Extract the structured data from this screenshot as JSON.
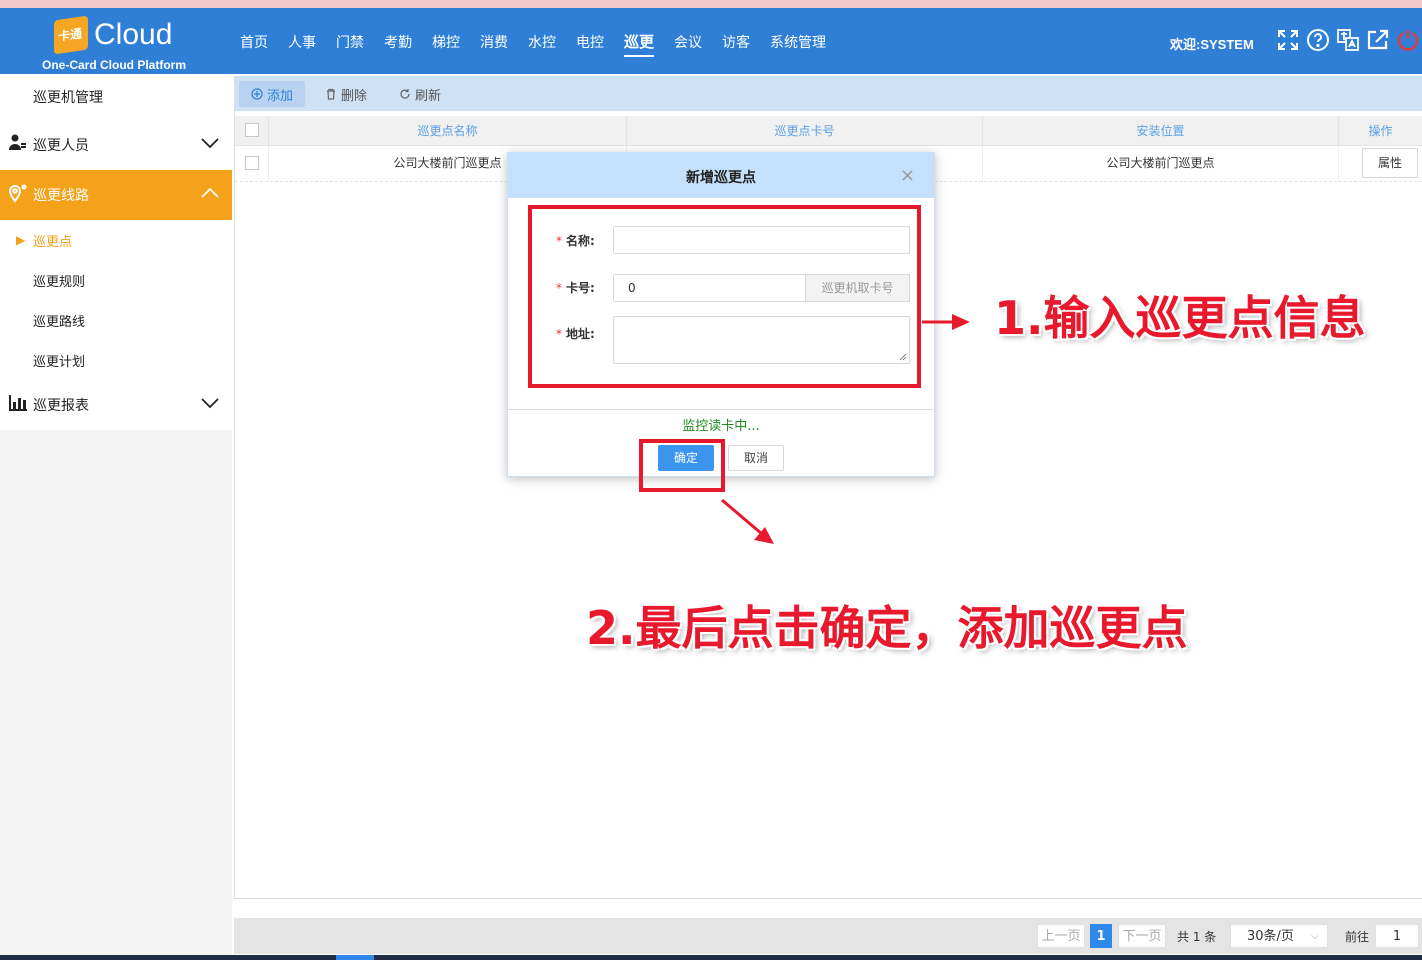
{
  "header": {
    "logo_mark": "卡通",
    "logo_text": "Cloud",
    "logo_sub": "One-Card Cloud Platform",
    "nav": [
      "首页",
      "人事",
      "门禁",
      "考勤",
      "梯控",
      "消费",
      "水控",
      "电控",
      "巡更",
      "会议",
      "访客",
      "系统管理"
    ],
    "active_nav": "巡更",
    "welcome": "欢迎:SYSTEM"
  },
  "sidebar": {
    "patrol_machine": "巡更机管理",
    "patrol_staff": "巡更人员",
    "patrol_route_group": "巡更线路",
    "sub_points": "巡更点",
    "sub_rules": "巡更规则",
    "sub_routes": "巡更路线",
    "sub_plans": "巡更计划",
    "patrol_report": "巡更报表"
  },
  "toolbar": {
    "add": "添加",
    "delete": "删除",
    "refresh": "刷新"
  },
  "table": {
    "columns": [
      "巡更点名称",
      "巡更点卡号",
      "安装位置",
      "操作"
    ],
    "rows": [
      {
        "name": "公司大楼前门巡更点",
        "card": "",
        "location": "公司大楼前门巡更点",
        "action": "属性"
      }
    ]
  },
  "dialog": {
    "title": "新增巡更点",
    "close": "×",
    "name_label": "名称:",
    "card_label": "卡号:",
    "address_label": "地址:",
    "required_mark": "*",
    "name_value": "",
    "card_value": "0",
    "address_value": "",
    "read_card_button": "巡更机取卡号",
    "status": "监控读卡中...",
    "ok": "确定",
    "cancel": "取消"
  },
  "pager": {
    "prev": "上一页",
    "current": "1",
    "next": "下一页",
    "total": "共 1 条",
    "page_size": "30条/页",
    "goto_label": "前往",
    "goto_value": "1"
  },
  "annotations": {
    "step1": "1.输入巡更点信息",
    "step2": "2.最后点击确定，添加巡更点"
  },
  "colors": {
    "header_bg": "#2f7fd7",
    "sidebar_active": "#f5a21b",
    "highlight_red": "#e8192c",
    "primary_button": "#3b94ee"
  }
}
